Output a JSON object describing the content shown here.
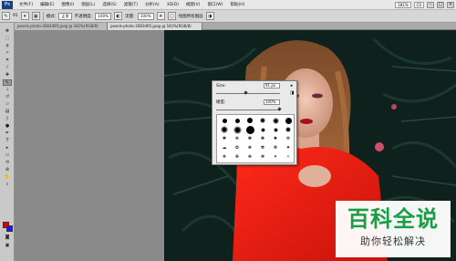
{
  "menubar": {
    "logo": "Ps",
    "items": [
      "文件(F)",
      "编辑(E)",
      "图像(I)",
      "图层(L)",
      "选择(S)",
      "滤镜(T)",
      "分析(A)",
      "3D(D)",
      "视图(V)",
      "窗口(W)",
      "帮助(H)"
    ],
    "zoom": "181%",
    "cs_badge": "CS"
  },
  "options": {
    "brush_size": "91",
    "mode_label": "模式:",
    "mode_value": "正常",
    "opacity_label": "不透明度:",
    "opacity_value": "100%",
    "flow_label": "流量:",
    "flow_value": "100%",
    "checkbox_label": "绘图所有图层"
  },
  "tabs": [
    {
      "label": "pexels-photo-2083495.jpeg @ 181%(RGB/8)"
    },
    {
      "label": "pexels-photo-2083495.jpeg @ 181%(RGB/8)"
    }
  ],
  "brush_panel": {
    "size_label": "Size:",
    "size_value": "91 px",
    "hardness_label": "硬度:",
    "hardness_value": "100%",
    "presets": [
      {
        "kind": "hard",
        "value": 9
      },
      {
        "kind": "hard",
        "value": 13
      },
      {
        "kind": "hard",
        "value": 19
      },
      {
        "kind": "soft",
        "value": 17
      },
      {
        "kind": "soft",
        "value": 45
      },
      {
        "kind": "hard",
        "value": 65
      },
      {
        "kind": "soft",
        "value": 100
      },
      {
        "kind": "soft",
        "value": 200
      },
      {
        "kind": "hard",
        "value": 300
      },
      {
        "kind": "soft",
        "value": 9
      },
      {
        "kind": "soft",
        "value": 13
      },
      {
        "kind": "soft",
        "value": 19
      },
      {
        "kind": "tex",
        "value": "✱"
      },
      {
        "kind": "tex",
        "value": "❋"
      },
      {
        "kind": "tex",
        "value": "✽"
      },
      {
        "kind": "tex",
        "value": "✺"
      },
      {
        "kind": "tex",
        "value": "✹"
      },
      {
        "kind": "tex",
        "value": "✻"
      },
      {
        "kind": "tex",
        "value": "☁"
      },
      {
        "kind": "tex",
        "value": "✿"
      },
      {
        "kind": "tex",
        "value": "❀"
      },
      {
        "kind": "tex",
        "value": "✾"
      },
      {
        "kind": "tex",
        "value": "❁"
      },
      {
        "kind": "tex",
        "value": "✷"
      },
      {
        "kind": "tex",
        "value": "❖"
      },
      {
        "kind": "tex",
        "value": "✤"
      },
      {
        "kind": "tex",
        "value": "✥"
      },
      {
        "kind": "tex",
        "value": "❃"
      },
      {
        "kind": "tex",
        "value": "✦"
      },
      {
        "kind": "tex",
        "value": "✧"
      }
    ]
  },
  "watermark": {
    "title": "百科全说",
    "subtitle": "助你轻松解决"
  },
  "colors": {
    "foreground": "#e00000",
    "background": "#1d1de0",
    "watermark_green": "#1a9e45"
  }
}
